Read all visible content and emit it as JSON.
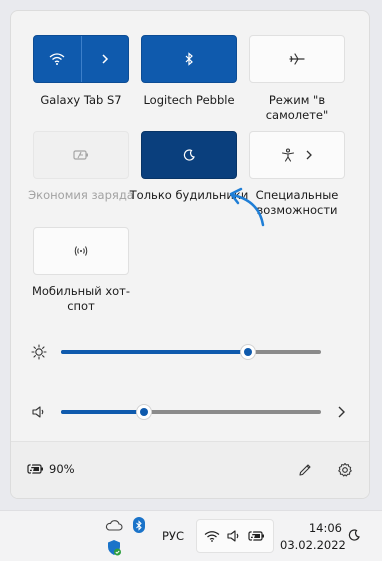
{
  "tiles": {
    "wifi": {
      "label": "Galaxy Tab S7",
      "icon": "wifi-icon",
      "state": "on"
    },
    "bluetooth": {
      "label": "Logitech Pebble",
      "icon": "bluetooth-icon",
      "state": "on"
    },
    "airplane": {
      "label": "Режим \"в самолете\"",
      "icon": "airplane-icon",
      "state": "off"
    },
    "battery_saver": {
      "label": "Экономия заряда",
      "icon": "battery-saver-icon",
      "state": "disabled"
    },
    "focus_assist": {
      "label": "Только будильники",
      "icon": "moon-icon",
      "state": "on"
    },
    "accessibility": {
      "label": "Специальные возможности",
      "icon": "accessibility-icon",
      "state": "off"
    },
    "hotspot": {
      "label": "Мобильный хот-спот",
      "icon": "hotspot-icon",
      "state": "off"
    }
  },
  "sliders": {
    "brightness": {
      "icon": "brightness-icon",
      "value_fraction": 0.72
    },
    "volume": {
      "icon": "speaker-icon",
      "value_fraction": 0.32
    }
  },
  "footer": {
    "battery_percent": "90%"
  },
  "taskbar": {
    "language": "РУС",
    "time": "14:06",
    "date": "03.02.2022"
  },
  "colors": {
    "accent": "#0f5aad",
    "accent_dark": "#0a3f7d",
    "annotation_arrow": "#1f7ed6"
  }
}
